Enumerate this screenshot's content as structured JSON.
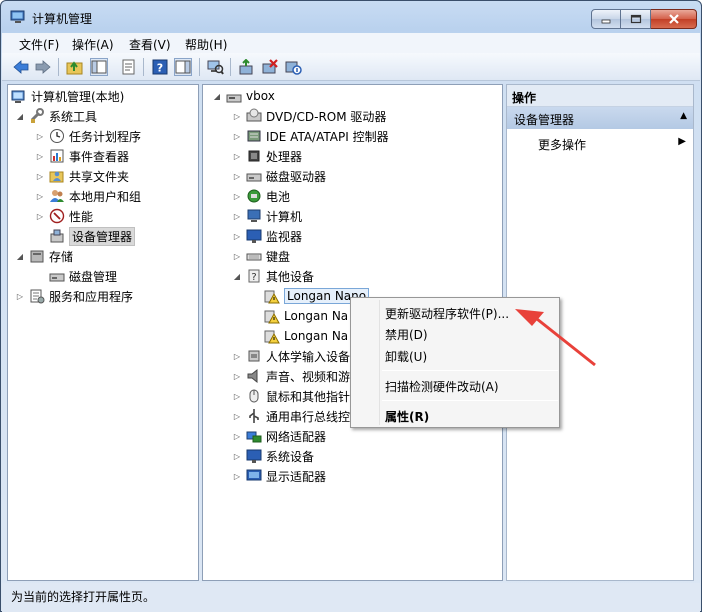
{
  "window": {
    "title": "计算机管理"
  },
  "menubar": {
    "items": [
      "文件(F)",
      "操作(A)",
      "查看(V)",
      "帮助(H)"
    ]
  },
  "left_tree": {
    "root": "计算机管理(本地)",
    "system_tools": "系统工具",
    "task_scheduler": "任务计划程序",
    "event_viewer": "事件查看器",
    "shared_folders": "共享文件夹",
    "local_users": "本地用户和组",
    "performance": "性能",
    "device_manager": "设备管理器",
    "storage": "存储",
    "disk_management": "磁盘管理",
    "services_apps": "服务和应用程序"
  },
  "device_tree": {
    "computer_name": "vbox",
    "categories": [
      "DVD/CD-ROM 驱动器",
      "IDE ATA/ATAPI 控制器",
      "处理器",
      "磁盘驱动器",
      "电池",
      "计算机",
      "监视器",
      "键盘",
      "其他设备"
    ],
    "other_devices": [
      "Longan Nano",
      "Longan Na",
      "Longan Na"
    ],
    "categories_after": [
      "人体学输入设备",
      "声音、视频和游",
      "鼠标和其他指针",
      "通用串行总线控",
      "网络适配器",
      "系统设备",
      "显示适配器"
    ]
  },
  "actions_pane": {
    "header": "操作",
    "section": "设备管理器",
    "more": "更多操作"
  },
  "context_menu": {
    "update_driver": "更新驱动程序软件(P)...",
    "disable": "禁用(D)",
    "uninstall": "卸载(U)",
    "scan": "扫描检测硬件改动(A)",
    "properties": "属性(R)"
  },
  "statusbar": {
    "text": "为当前的选择打开属性页。"
  },
  "colors": {
    "arrow": "#e8413a",
    "titlebar": "#b9d1ee",
    "selection": "#d9d9d9"
  }
}
